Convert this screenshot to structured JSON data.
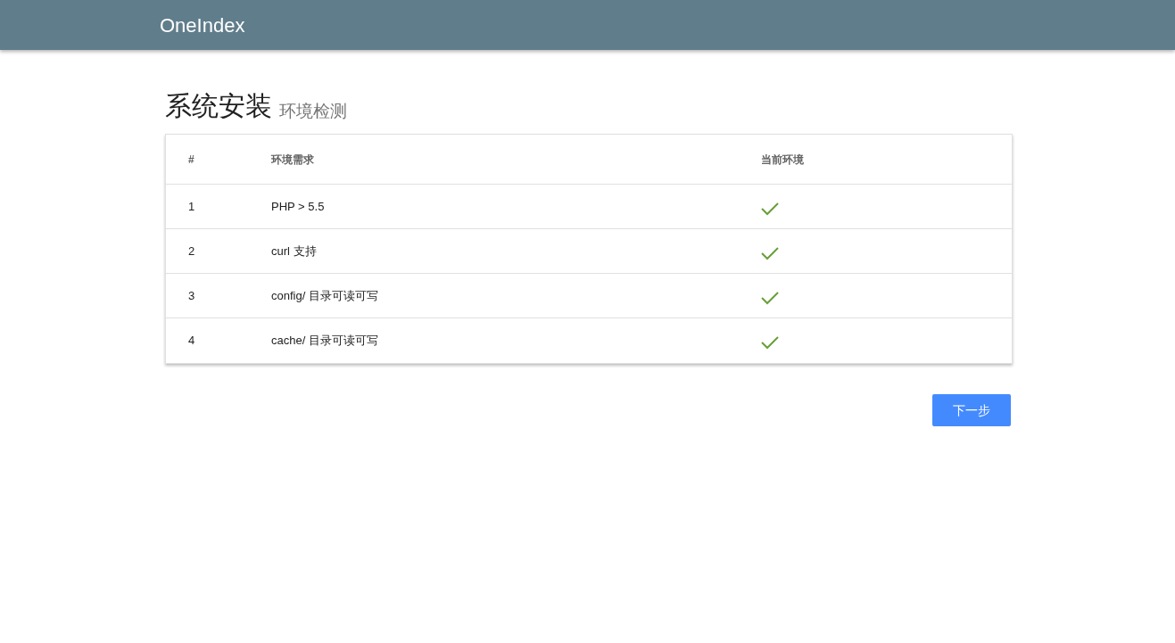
{
  "app_bar": {
    "title": "OneIndex"
  },
  "page": {
    "title": "系统安装",
    "subtitle": "环境检测"
  },
  "table": {
    "columns": [
      "#",
      "环境需求",
      "当前环境"
    ],
    "rows": [
      {
        "index": "1",
        "requirement": "PHP > 5.5",
        "passed": true
      },
      {
        "index": "2",
        "requirement": "curl 支持",
        "passed": true
      },
      {
        "index": "3",
        "requirement": "config/ 目录可读可写",
        "passed": true
      },
      {
        "index": "4",
        "requirement": "cache/ 目录可读可写",
        "passed": true
      }
    ]
  },
  "next_button": {
    "label": "下一步"
  }
}
